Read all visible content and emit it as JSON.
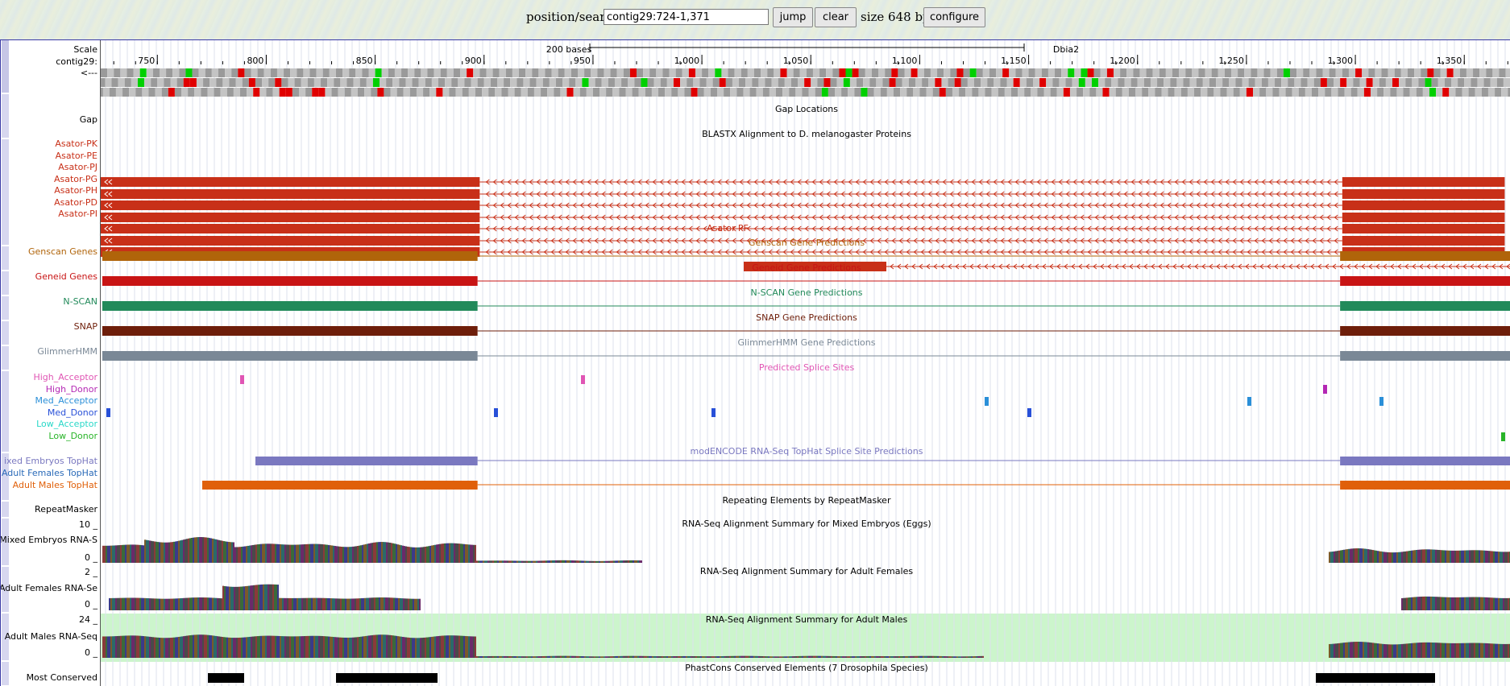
{
  "header": {
    "position_label": "position/search",
    "position_value": "contig29:724-1,371",
    "jump_label": "jump",
    "clear_label": "clear",
    "size_text": "size 648 bp.",
    "configure_label": "configure"
  },
  "ruler": {
    "scale_label": "Scale",
    "contig_label": "contig29:",
    "strand_label": "<---",
    "scale_bar_text": "200 bases",
    "assembly_label": "Dbia2",
    "ticks": [
      "750",
      "800",
      "850",
      "900",
      "950",
      "1,000",
      "1,050",
      "1,100",
      "1,150",
      "1,200",
      "1,250",
      "1,300",
      "1,350"
    ]
  },
  "tracks": {
    "gap": {
      "label": "Gap",
      "title": "Gap Locations"
    },
    "blastx": {
      "title": "BLASTX Alignment to D. melanogaster Proteins",
      "items": [
        "Asator-PK",
        "Asator-PE",
        "Asator-PJ",
        "Asator-PG",
        "Asator-PH",
        "Asator-PD",
        "Asator-PI"
      ],
      "extra_item": "Asator-PF",
      "color": "#c83018"
    },
    "genscan": {
      "label": "Genscan Genes",
      "title": "Genscan Gene Predictions",
      "color": "#b0640a"
    },
    "geneid": {
      "label": "Geneid Genes",
      "title": "Geneid Gene Predictions",
      "color": "#c81414"
    },
    "nscan": {
      "label": "N-SCAN",
      "title": "N-SCAN Gene Predictions",
      "color": "#228a5a"
    },
    "snap": {
      "label": "SNAP",
      "title": "SNAP Gene Predictions",
      "color": "#6e1e0a"
    },
    "glimmer": {
      "label": "GlimmerHMM",
      "title": "GlimmerHMM Gene Predictions",
      "color": "#7a8896"
    },
    "splice": {
      "title": "Predicted Splice Sites",
      "items": [
        {
          "label": "High_Acceptor",
          "color": "#e055b4"
        },
        {
          "label": "High_Donor",
          "color": "#b428b4"
        },
        {
          "label": "Med_Acceptor",
          "color": "#2a8fd8"
        },
        {
          "label": "Med_Donor",
          "color": "#2850d8"
        },
        {
          "label": "Low_Acceptor",
          "color": "#28d8c8"
        },
        {
          "label": "Low_Donor",
          "color": "#28b428"
        }
      ]
    },
    "tophat": {
      "title": "modENCODE RNA-Seq TopHat Splice Site Predictions",
      "items": [
        {
          "label": "ixed Embryos TopHat",
          "color": "#7a78c0"
        },
        {
          "label": "Adult Females TopHat",
          "color": "#2a6ab8"
        },
        {
          "label": "Adult Males TopHat",
          "color": "#e0600a"
        }
      ]
    },
    "repeatmasker": {
      "label": "RepeatMasker",
      "title": "Repeating Elements by RepeatMasker"
    },
    "rnaseq_embryos": {
      "label": "Mixed Embryos RNA-S",
      "title": "RNA-Seq Alignment Summary for Mixed Embryos (Eggs)",
      "max": "10 _",
      "min": "0 _"
    },
    "rnaseq_females": {
      "label": "Adult Females RNA-Se",
      "title": "RNA-Seq Alignment Summary for Adult Females",
      "max": "2 _",
      "min": "0 _"
    },
    "rnaseq_males": {
      "label": "Adult Males RNA-Seq",
      "title": "RNA-Seq Alignment Summary for Adult Males",
      "max": "24 _",
      "min": "0 _"
    },
    "phastcons": {
      "label": "Most Conserved",
      "title": "PhastCons Conserved Elements (7 Drosophila Species)"
    }
  }
}
